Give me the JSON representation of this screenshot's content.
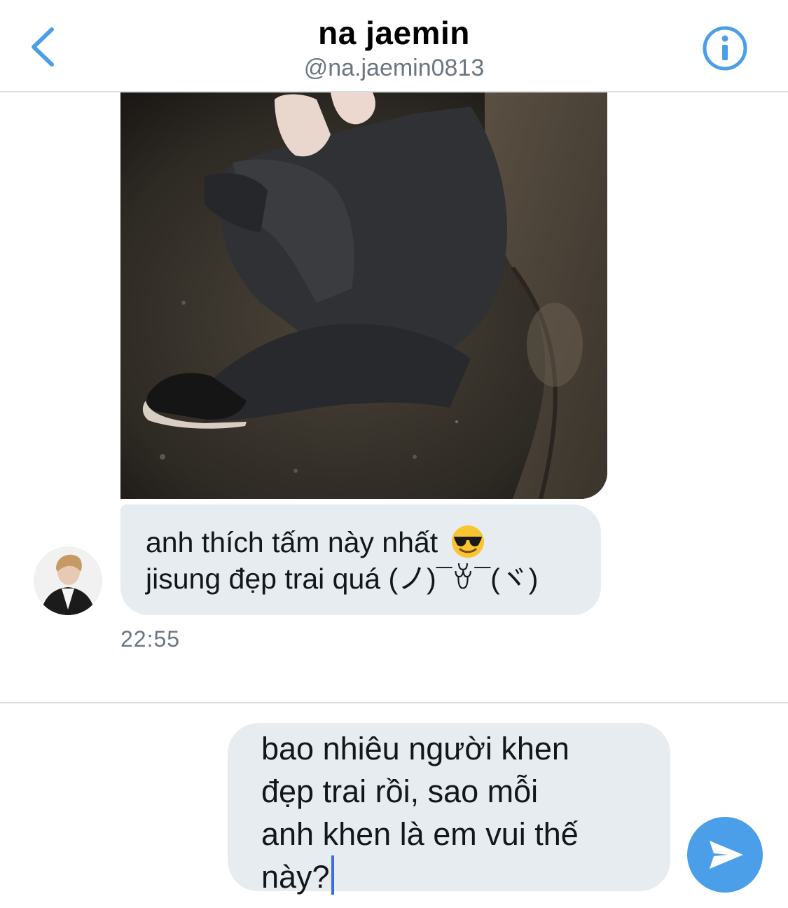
{
  "header": {
    "title": "na jaemin",
    "handle": "@na.jaemin0813",
    "back_icon": "chevron-left-icon",
    "info_icon": "info-icon"
  },
  "conversation": {
    "received_message": {
      "lines": [
        "anh thích tấm này nhất",
        "jisung đẹp trai quá (ノ)¯ꈊ¯(ヾ)"
      ],
      "emoji": "smiling-face-with-sunglasses",
      "timestamp": "22:55"
    }
  },
  "compose": {
    "draft_lines": [
      "bao nhiêu người khen",
      "đẹp trai rồi, sao mỗi",
      "anh khen là em vui thế",
      "này?"
    ],
    "send_icon": "send-icon"
  },
  "colors": {
    "accent": "#4a9fe8",
    "bubble": "#e6ecf0",
    "secondary_text": "#6b7580",
    "divider": "#dadde1"
  }
}
